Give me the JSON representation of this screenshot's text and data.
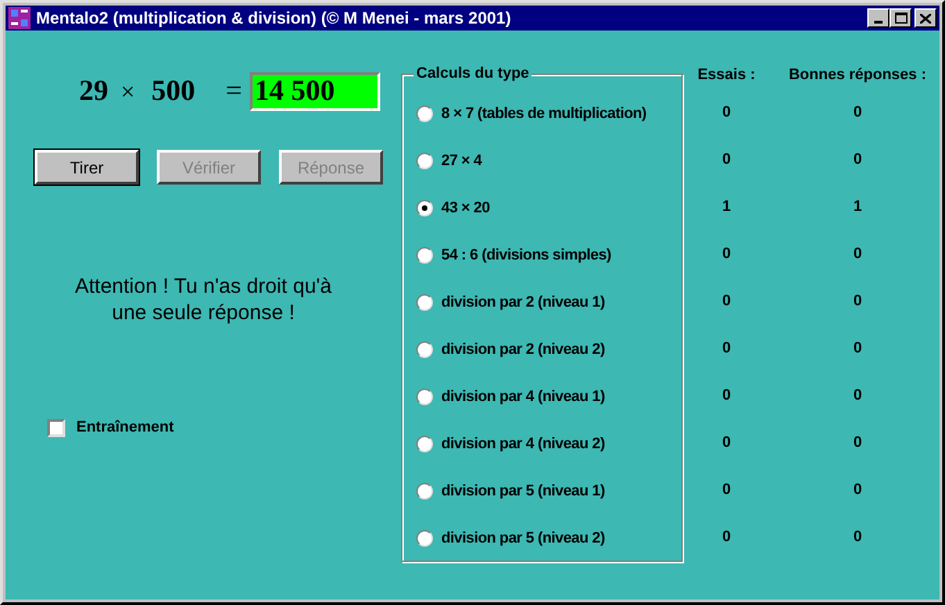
{
  "window": {
    "title": "Mentalo2 (multiplication & division) (© M Menei - mars 2001)"
  },
  "equation": {
    "operand_1": "29",
    "operator": "×",
    "operand_2": "500",
    "equals": "=",
    "answer": "14 500"
  },
  "buttons": [
    {
      "label": "Tirer",
      "disabled": false,
      "focused": true
    },
    {
      "label": "Vérifier",
      "disabled": true,
      "focused": false
    },
    {
      "label": "Réponse",
      "disabled": true,
      "focused": false
    }
  ],
  "message": "Attention ! Tu n'as droit qu'à une seule réponse !",
  "training": {
    "label": "Entraînement",
    "checked": false
  },
  "group": {
    "title": "Calculs du type",
    "columns": [
      "Essais :",
      "Bonnes réponses :"
    ],
    "rows": [
      {
        "label": "8 × 7 (tables de multiplication)",
        "selected": false,
        "tries": "0",
        "correct": "0"
      },
      {
        "label": "27 × 4",
        "selected": false,
        "tries": "0",
        "correct": "0"
      },
      {
        "label": "43 × 20",
        "selected": true,
        "tries": "1",
        "correct": "1"
      },
      {
        "label": "54 : 6 (divisions simples)",
        "selected": false,
        "tries": "0",
        "correct": "0"
      },
      {
        "label": "division par 2 (niveau 1)",
        "selected": false,
        "tries": "0",
        "correct": "0"
      },
      {
        "label": "division par 2 (niveau 2)",
        "selected": false,
        "tries": "0",
        "correct": "0"
      },
      {
        "label": "division par 4 (niveau 1)",
        "selected": false,
        "tries": "0",
        "correct": "0"
      },
      {
        "label": "division par 4 (niveau 2)",
        "selected": false,
        "tries": "0",
        "correct": "0"
      },
      {
        "label": "division par 5 (niveau 1)",
        "selected": false,
        "tries": "0",
        "correct": "0"
      },
      {
        "label": "division par 5 (niveau 2)",
        "selected": false,
        "tries": "0",
        "correct": "0"
      }
    ]
  }
}
